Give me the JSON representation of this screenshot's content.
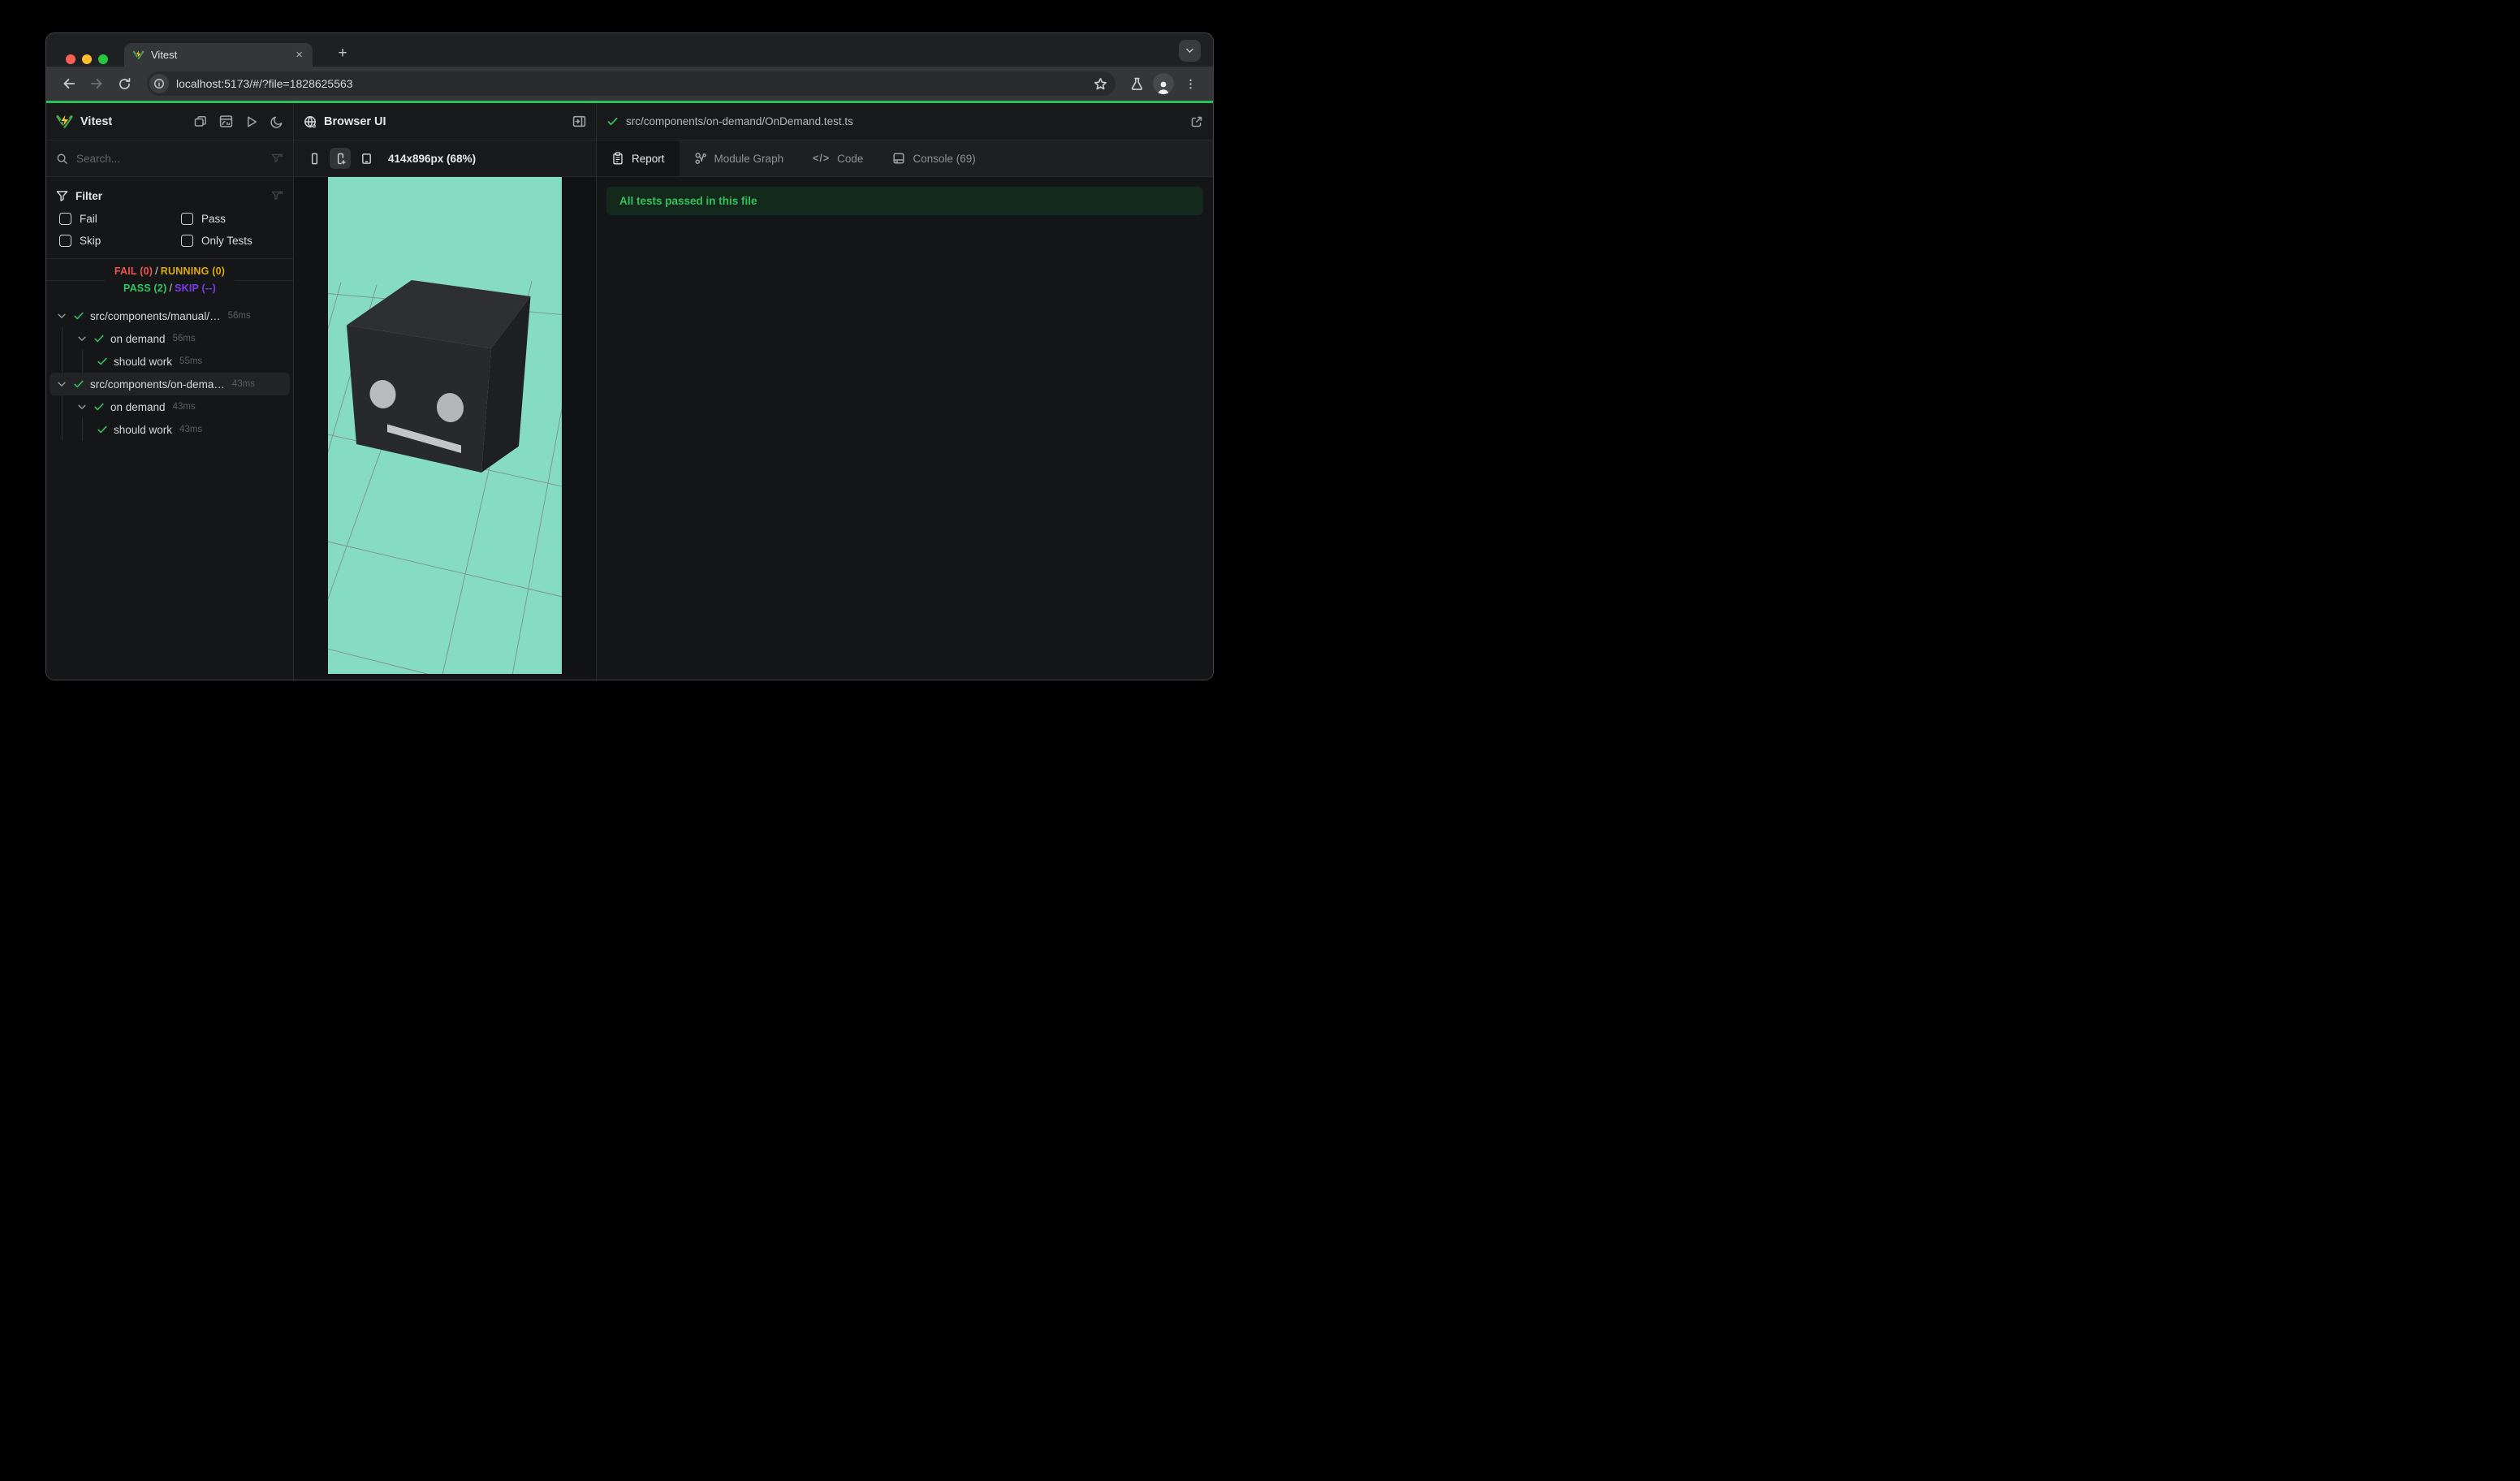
{
  "chrome": {
    "tab_title": "Vitest",
    "close_glyph": "×",
    "newtab_glyph": "+",
    "url": "localhost:5173/#/?file=1828625563"
  },
  "sidebar": {
    "app_title": "Vitest",
    "search_placeholder": "Search...",
    "filter": {
      "title": "Filter",
      "options": [
        {
          "label": "Fail"
        },
        {
          "label": "Pass"
        },
        {
          "label": "Skip"
        },
        {
          "label": "Only Tests"
        }
      ]
    },
    "summary": {
      "fail": "FAIL (0)",
      "running": "RUNNING (0)",
      "pass": "PASS (2)",
      "skip": "SKIP (--)",
      "sep": "/"
    },
    "tree": [
      {
        "label": "src/components/manual/…",
        "time": "56ms"
      },
      {
        "label": "on demand",
        "time": "56ms"
      },
      {
        "label": "should work",
        "time": "55ms"
      },
      {
        "label": "src/components/on-dema…",
        "time": "43ms"
      },
      {
        "label": "on demand",
        "time": "43ms"
      },
      {
        "label": "should work",
        "time": "43ms"
      }
    ]
  },
  "preview": {
    "panel_title": "Browser UI",
    "size_label": "414x896px (68%)"
  },
  "report": {
    "file_path": "src/components/on-demand/OnDemand.test.ts",
    "tabs": [
      {
        "label": "Report"
      },
      {
        "label": "Module Graph"
      },
      {
        "label": "Code",
        "icon_glyph": "</>"
      },
      {
        "label": "Console (69)"
      }
    ],
    "banner": "All tests passed in this file"
  },
  "colors": {
    "progress_green": "#2bc158",
    "pass_green": "#2fc763",
    "fail_red": "#ef5350",
    "running_yellow": "#deab0b",
    "skip_purple": "#7c3aed",
    "banner_text": "#35c25d",
    "banner_bg": "#13291b",
    "scene_mint": "#85dcc1",
    "logo_yellow": "#fcc72b",
    "logo_green": "#44a94c"
  }
}
